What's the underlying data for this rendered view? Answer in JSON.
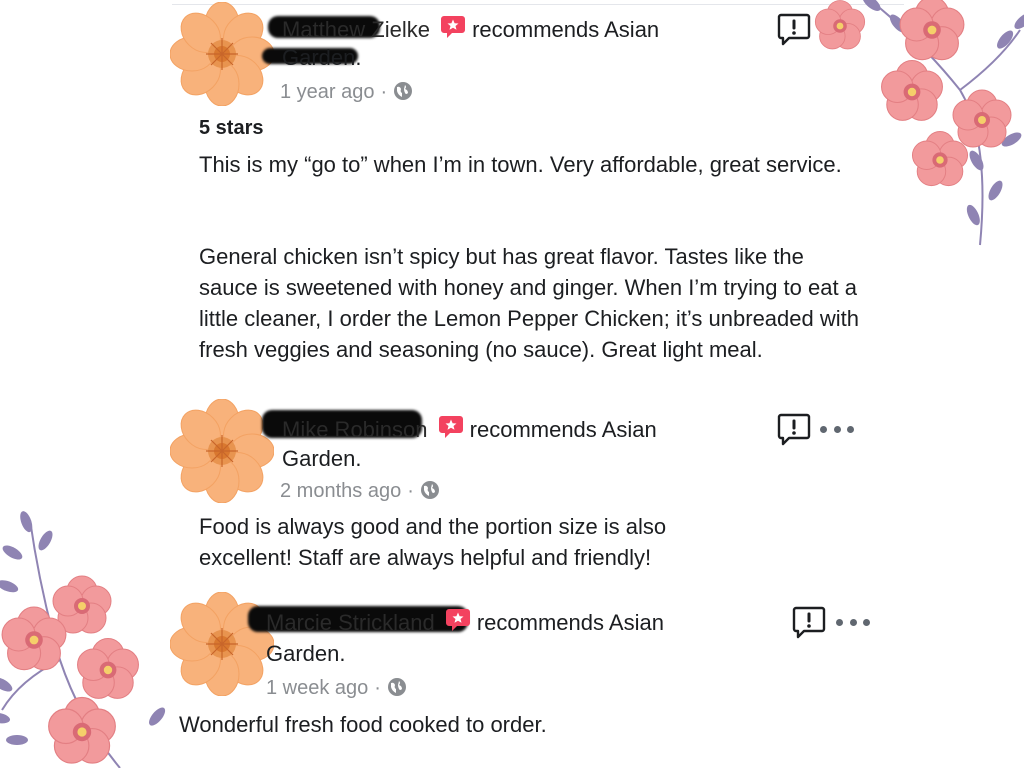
{
  "reviews": [
    {
      "name": "Matthew Zielke",
      "action": "recommends Asian",
      "action_cont": "Garden.",
      "time": "1 year ago",
      "dot": "·",
      "rating": "5 stars",
      "paragraphs": [
        "This is my “go to” when I’m in town. Very affordable, great service.",
        "General chicken isn’t spicy but has great flavor. Tastes like the sauce is sweetened with honey and ginger. When I’m trying to eat a little cleaner, I order the Lemon Pepper Chicken; it’s unbreaded with fresh veggies and seasoning (no sauce). Great light meal."
      ]
    },
    {
      "name": "Mike Robinson",
      "action": "recommends Asian",
      "action_cont": "Garden.",
      "time": "2 months ago",
      "dot": "·",
      "paragraphs": [
        "Food is always good and the portion size is also excellent!  Staff are always helpful and friendly!"
      ]
    },
    {
      "name": "Marcie Strickland",
      "action": "recommends Asian",
      "action_cont": "Garden.",
      "time": "1 week ago",
      "dot": "·",
      "paragraphs": [
        "Wonderful fresh food cooked to order."
      ]
    }
  ],
  "icons": {
    "recommend": "recommend-badge-icon",
    "privacy": "globe-icon",
    "report": "report-icon",
    "more": "more-options-icon",
    "avatar": "flower-avatar",
    "decoration": "floral-decoration"
  },
  "colors": {
    "recommend_badge": "#f3425f",
    "meta_gray": "#8a8d91",
    "text": "#1c1e21",
    "avatar_petal": "#f9b37a",
    "flower_pink": "#ef8a8f"
  }
}
